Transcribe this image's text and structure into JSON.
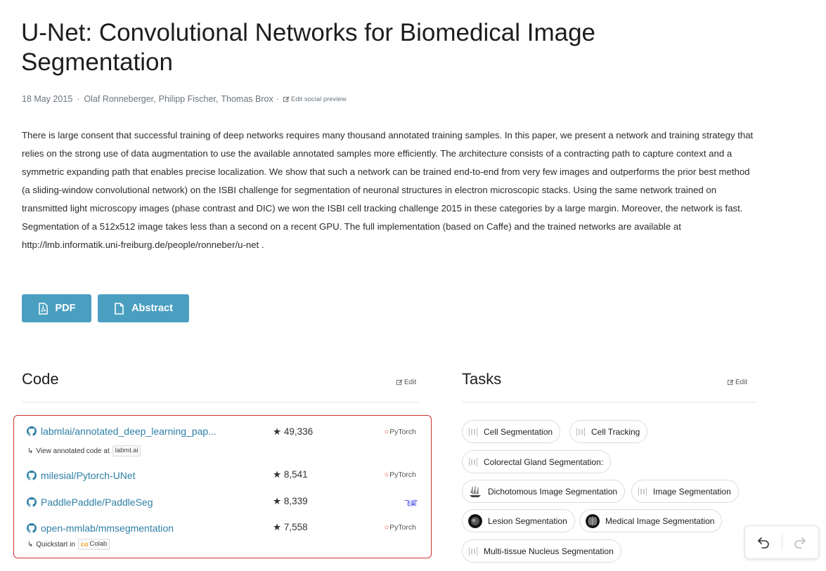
{
  "paper": {
    "title": "U-Net: Convolutional Networks for Biomedical Image Segmentation",
    "date": "18 May 2015",
    "sep": "·",
    "authors": [
      "Olaf Ronneberger,",
      "Philipp Fischer,",
      "Thomas Brox"
    ],
    "edit_preview": "Edit social preview",
    "abstract": "There is large consent that successful training of deep networks requires many thousand annotated training samples. In this paper, we present a network and training strategy that relies on the strong use of data augmentation to use the available annotated samples more efficiently. The architecture consists of a contracting path to capture context and a symmetric expanding path that enables precise localization. We show that such a network can be trained end-to-end from very few images and outperforms the prior best method (a sliding-window convolutional network) on the ISBI challenge for segmentation of neuronal structures in electron microscopic stacks. Using the same network trained on transmitted light microscopy images (phase contrast and DIC) we won the ISBI cell tracking challenge 2015 in these categories by a large margin. Moreover, the network is fast. Segmentation of a 512x512 image takes less than a second on a recent GPU. The full implementation (based on Caffe) and the trained networks are available at http://lmb.informatik.uni-freiburg.de/people/ronneber/u-net ."
  },
  "buttons": {
    "pdf": "PDF",
    "abstract": "Abstract"
  },
  "code": {
    "title": "Code",
    "edit": "Edit",
    "repos": [
      {
        "name": "labmlai/annotated_deep_learning_pap...",
        "stars": "★ 49,336",
        "framework": "PyTorch",
        "sub_prefix": "View annotated code at",
        "sub_link": "labml.ai"
      },
      {
        "name": "milesial/Pytorch-UNet",
        "stars": "★ 8,541",
        "framework": "PyTorch"
      },
      {
        "name": "PaddlePaddle/PaddleSeg",
        "stars": "★ 8,339",
        "framework": "飞桨"
      },
      {
        "name": "open-mmlab/mmsegmentation",
        "stars": "★ 7,558",
        "framework": "PyTorch",
        "sub_prefix": "Quickstart in",
        "sub_link": "Colab"
      }
    ]
  },
  "tasks": {
    "title": "Tasks",
    "edit": "Edit",
    "items": [
      "Cell Segmentation",
      "Cell Tracking",
      "Colorectal Gland Segmentation:",
      "Dichotomous Image Segmentation",
      "Image Segmentation",
      "Lesion Segmentation",
      "Medical Image Segmentation",
      "Multi-tissue Nucleus Segmentation"
    ]
  },
  "colors": {
    "accent": "#4a9fc1",
    "link": "#2e7fa6",
    "highlight_border": "#d0312d",
    "pytorch": "#ee4c2c"
  }
}
